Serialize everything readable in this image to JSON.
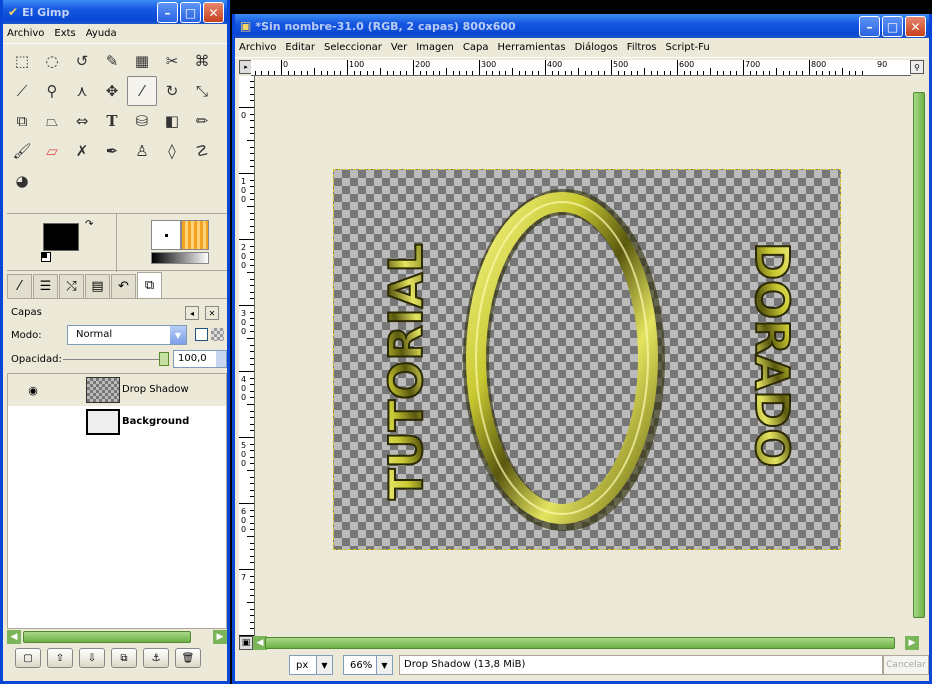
{
  "toolbox": {
    "title": "El Gimp",
    "menu": [
      "Archivo",
      "Exts",
      "Ayuda"
    ],
    "tools": [
      "rect-select",
      "ellipse-select",
      "free-select",
      "fuzzy-select",
      "color-select",
      "scissors",
      "foreground-select",
      "paths",
      "color-picker",
      "zoom",
      "measure",
      "move",
      "crop",
      "rotate",
      "scale",
      "shear",
      "perspective",
      "flip",
      "text",
      "bucket-fill",
      "blend",
      "pencil",
      "paintbrush",
      "eraser",
      "airbrush",
      "ink",
      "clone",
      "heal",
      "perspective-clone",
      "blur",
      "smudge",
      "dodge-burn"
    ],
    "layers": {
      "header": "Capas",
      "mode_label": "Modo:",
      "mode_value": "Normal",
      "opacity_label": "Opacidad:",
      "opacity_value": "100,0",
      "opacity": 1.0,
      "items": [
        {
          "name": "Drop Shadow",
          "visible": true,
          "selected": true
        },
        {
          "name": "Background",
          "visible": false,
          "selected": false
        }
      ]
    }
  },
  "image_window": {
    "title": "*Sin nombre-31.0 (RGB, 2 capas) 800x600",
    "menu": [
      "Archivo",
      "Editar",
      "Seleccionar",
      "Ver",
      "Imagen",
      "Capa",
      "Herramientas",
      "Diálogos",
      "Filtros",
      "Script-Fu"
    ],
    "ruler_h": [
      "-100",
      "0",
      "100",
      "200",
      "300",
      "400",
      "500",
      "600",
      "700",
      "800",
      "90"
    ],
    "ruler_v": [
      "1 0 0",
      "0",
      "1 0 0",
      "2 0 0",
      "3 0 0",
      "4 0 0",
      "5 0 0",
      "6 0 0",
      "7"
    ],
    "unit": "px",
    "zoom": "66%",
    "status": "Drop Shadow (13,8 MiB)",
    "cancel": "Cancelar"
  },
  "artwork": {
    "left_text": "TUTORIAL",
    "right_text": "DORADO",
    "gold_light": "#f2f27a",
    "gold_mid": "#c8c832",
    "gold_dark": "#4c4a0a"
  }
}
